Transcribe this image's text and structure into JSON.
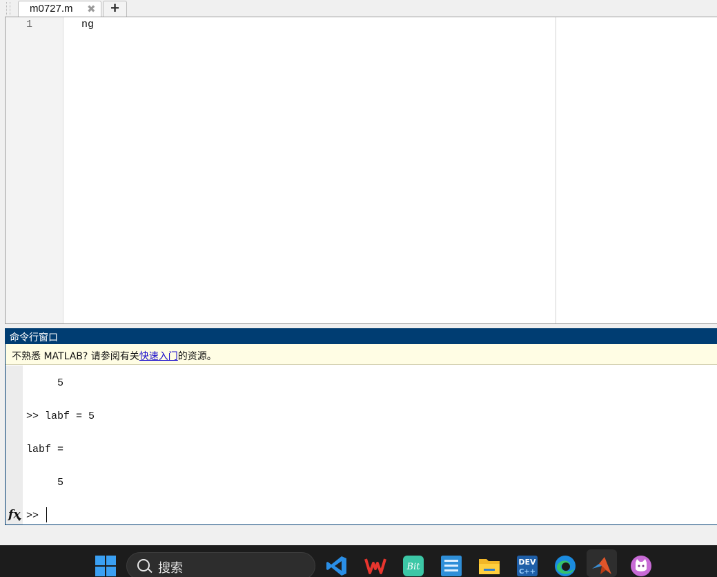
{
  "editor": {
    "tab_label": "m0727.m",
    "close_glyph": "✖",
    "add_glyph": "+",
    "line_numbers": [
      "1"
    ],
    "code_lines": [
      "ng"
    ]
  },
  "command_window": {
    "title": "命令行窗口",
    "notice_prefix": "不熟悉 MATLAB? 请参阅有关",
    "notice_link": "快速入门",
    "notice_suffix": "的资源。",
    "output_lines": [
      "     5",
      ">> labf = 5",
      "labf =",
      "     5"
    ],
    "fx_label": "fx",
    "prompt": ">>"
  },
  "taskbar": {
    "search_placeholder": "搜索",
    "apps": [
      "windows-start",
      "vscode",
      "wps-office",
      "bit-app",
      "shabai-language",
      "file-explorer",
      "dev-cpp",
      "edge",
      "matlab",
      "cat-app"
    ],
    "accent_colors": {
      "matlab_title": "#003d72",
      "notice_bg": "#fffde4",
      "taskbar": "#1c1c1c"
    }
  }
}
